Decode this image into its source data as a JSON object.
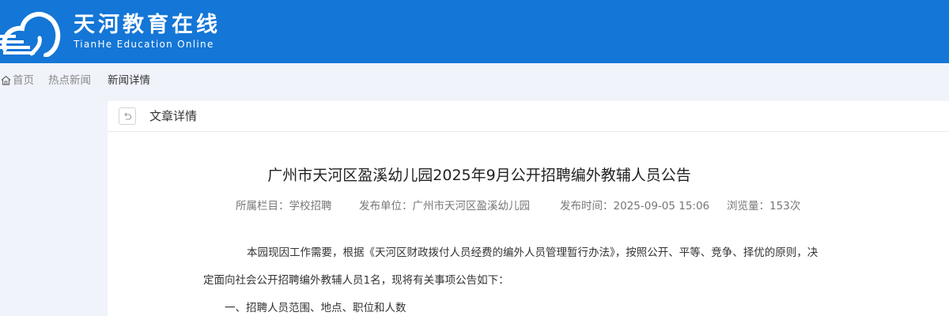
{
  "header": {
    "title": "天河教育在线",
    "subtitle": "TianHe Education Online",
    "background": "#1476d6",
    "logo_icon": "cloud-wave-icon"
  },
  "breadcrumb": {
    "home_icon": "home-icon",
    "items": [
      "首页",
      "热点新闻",
      "新闻详情"
    ]
  },
  "panel": {
    "back_icon": "undo-arrow-icon",
    "title": "文章详情"
  },
  "article": {
    "title": "广州市天河区盈溪幼儿园2025年9月公开招聘编外教辅人员公告",
    "meta": {
      "column": "所属栏目：学校招聘",
      "publisher": "发布单位：广州市天河区盈溪幼儿园",
      "time": "发布时间：2025-09-05 15:06",
      "views": "浏览量：153次"
    },
    "paragraphs": [
      "本园现因工作需要，根据《天河区财政拨付人员经费的编外人员管理暂行办法》，按照公开、平等、竞争、择优的原则，决",
      "定面向社会公开招聘编外教辅人员1名，现将有关事项公告如下：",
      "一、招聘人员范围、地点、职位和人数"
    ]
  }
}
